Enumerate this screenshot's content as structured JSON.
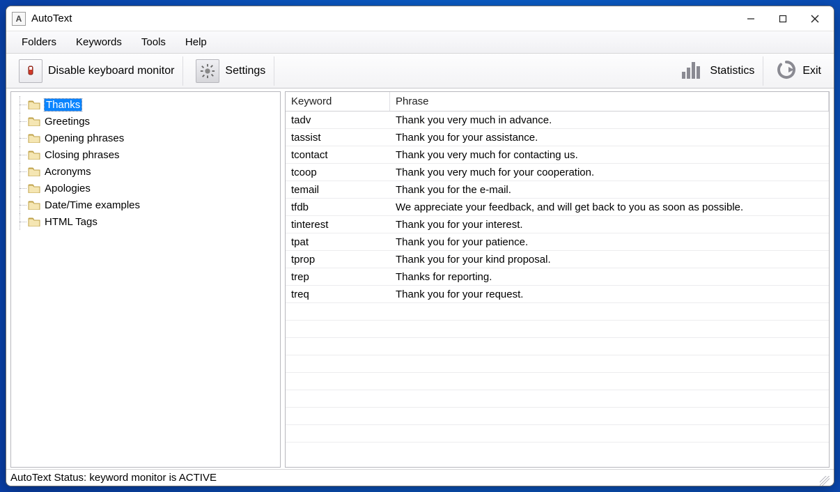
{
  "window": {
    "title": "AutoText",
    "app_icon_letter": "A"
  },
  "menubar": {
    "items": [
      "Folders",
      "Keywords",
      "Tools",
      "Help"
    ]
  },
  "toolbar": {
    "disable_monitor": "Disable keyboard monitor",
    "settings": "Settings",
    "statistics": "Statistics",
    "exit": "Exit"
  },
  "sidebar": {
    "folders": [
      {
        "label": "Thanks",
        "selected": true
      },
      {
        "label": "Greetings",
        "selected": false
      },
      {
        "label": "Opening phrases",
        "selected": false
      },
      {
        "label": "Closing phrases",
        "selected": false
      },
      {
        "label": "Acronyms",
        "selected": false
      },
      {
        "label": "Apologies",
        "selected": false
      },
      {
        "label": "Date/Time examples",
        "selected": false
      },
      {
        "label": "HTML Tags",
        "selected": false
      }
    ]
  },
  "table": {
    "columns": {
      "keyword": "Keyword",
      "phrase": "Phrase"
    },
    "rows": [
      {
        "keyword": "tadv",
        "phrase": "Thank you very much in advance."
      },
      {
        "keyword": "tassist",
        "phrase": "Thank you for your assistance."
      },
      {
        "keyword": "tcontact",
        "phrase": "Thank you very much for contacting us."
      },
      {
        "keyword": "tcoop",
        "phrase": "Thank you very much for your cooperation."
      },
      {
        "keyword": "temail",
        "phrase": "Thank you for the e-mail."
      },
      {
        "keyword": "tfdb",
        "phrase": "We appreciate your feedback, and will get back to you as soon as possible."
      },
      {
        "keyword": "tinterest",
        "phrase": "Thank you for your interest."
      },
      {
        "keyword": "tpat",
        "phrase": "Thank you for your patience."
      },
      {
        "keyword": "tprop",
        "phrase": "Thank you for your kind proposal."
      },
      {
        "keyword": "trep",
        "phrase": "Thanks for reporting."
      },
      {
        "keyword": "treq",
        "phrase": "Thank you for your request."
      }
    ],
    "blank_rows": 8
  },
  "statusbar": {
    "text": "AutoText Status: keyword monitor is ACTIVE"
  }
}
